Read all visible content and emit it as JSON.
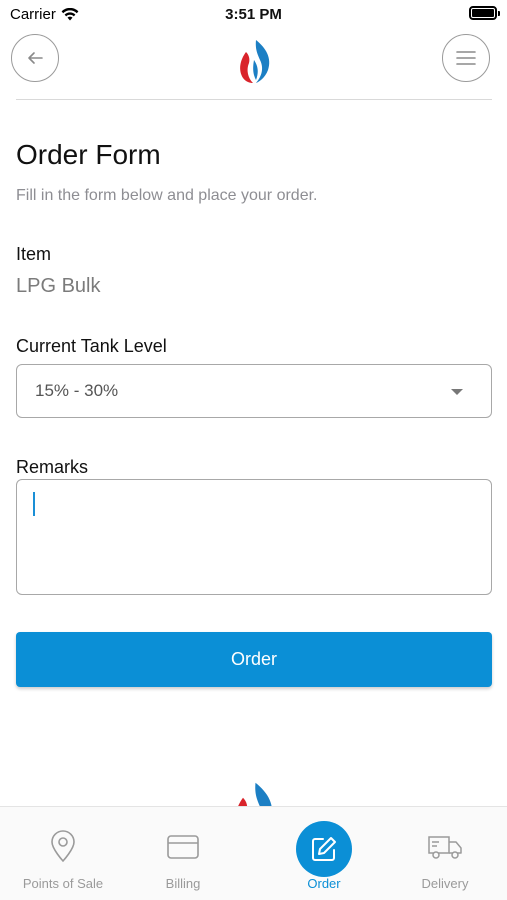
{
  "status_bar": {
    "carrier": "Carrier",
    "time": "3:51 PM"
  },
  "header": {
    "back_icon": "arrow-left-icon",
    "menu_icon": "hamburger-menu-icon",
    "logo": "flame-logo"
  },
  "form": {
    "title": "Order Form",
    "subtitle": "Fill in the form below and place your order.",
    "item_label": "Item",
    "item_value": "LPG Bulk",
    "tank_level_label": "Current Tank Level",
    "tank_level_value": "15% - 30%",
    "remarks_label": "Remarks",
    "remarks_value": "",
    "order_button": "Order"
  },
  "tabbar": {
    "tabs": [
      {
        "label": "Points of Sale",
        "icon": "map-pin-icon"
      },
      {
        "label": "Billing",
        "icon": "credit-card-icon"
      },
      {
        "label": "Order",
        "icon": "edit-icon",
        "active": true
      },
      {
        "label": "Delivery",
        "icon": "truck-icon"
      }
    ]
  },
  "colors": {
    "accent": "#0b8fd6",
    "logo_red": "#d9242b",
    "logo_blue": "#1c7fc4"
  }
}
